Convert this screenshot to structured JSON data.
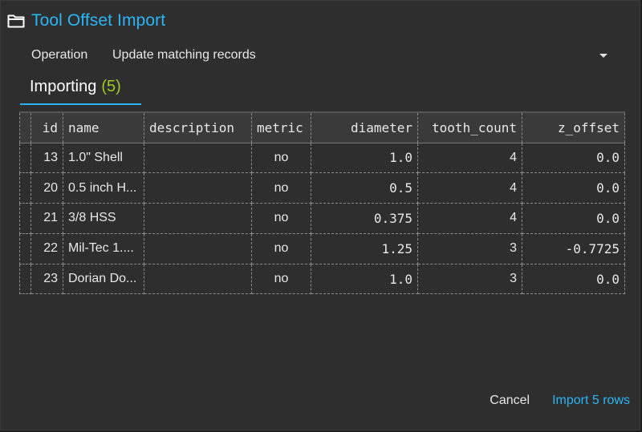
{
  "dialog": {
    "title": "Tool Offset Import",
    "icon": "folder-icon"
  },
  "operation": {
    "label": "Operation",
    "value": "Update matching records"
  },
  "tab": {
    "label": "Importing",
    "count": "(5)"
  },
  "table": {
    "columns": [
      "id",
      "name",
      "description",
      "metric",
      "diameter",
      "tooth_count",
      "z_offset"
    ],
    "rows": [
      [
        "13",
        "1.0\" Shell",
        "",
        "no",
        "1.0",
        "4",
        "0.0"
      ],
      [
        "20",
        "0.5 inch H...",
        "",
        "no",
        "0.5",
        "4",
        "0.0"
      ],
      [
        "21",
        "3/8 HSS",
        "",
        "no",
        "0.375",
        "4",
        "0.0"
      ],
      [
        "22",
        "Mil-Tec 1....",
        "",
        "no",
        "1.25",
        "3",
        "-0.7725"
      ],
      [
        "23",
        "Dorian Do...",
        "",
        "no",
        "1.0",
        "3",
        "0.0"
      ]
    ]
  },
  "actions": {
    "cancel": "Cancel",
    "import": "Import 5 rows"
  },
  "colors": {
    "accent": "#29b6f6",
    "count": "#9ccc22",
    "background": "#2e2e2e"
  }
}
